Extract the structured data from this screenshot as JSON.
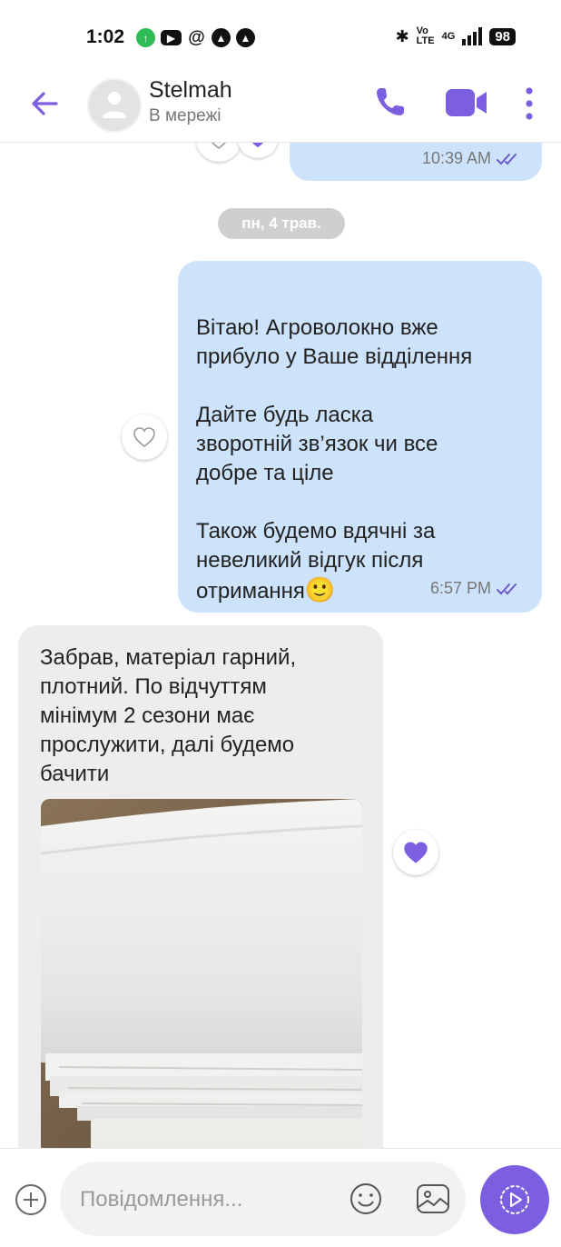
{
  "status_bar": {
    "time": "1:02",
    "network_label": "Vo\nLTE",
    "signal_label": "4G",
    "battery": "98"
  },
  "header": {
    "contact_name": "Stelmah",
    "contact_status": "В мережі"
  },
  "messages": [
    {
      "direction": "outgoing",
      "time": "10:39 AM",
      "read": true
    },
    {
      "type": "date",
      "label": "пн, 4 трав."
    },
    {
      "direction": "outgoing",
      "text": "Вітаю! Агроволокно вже\nприбуло у Ваше відділення\n\nДайте будь ласка\nзворотній зв’язок чи все\nдобре та ціле\n\nТакож будемо вдячні за\nневеликий відгук після\nотримання",
      "emoji": "🙂",
      "time": "6:57 PM",
      "read": true
    },
    {
      "direction": "incoming",
      "text": "Забрав, матеріал гарний,\nплотний. По відчуттям\nмінімум 2 сезони має\nпрослужити, далі будемо\nбачити",
      "liked": true
    }
  ],
  "composer": {
    "placeholder": "Повідомлення..."
  },
  "colors": {
    "accent": "#7b5fe0",
    "outgoing_bubble": "#cde3fb",
    "incoming_bubble": "#ededed"
  }
}
